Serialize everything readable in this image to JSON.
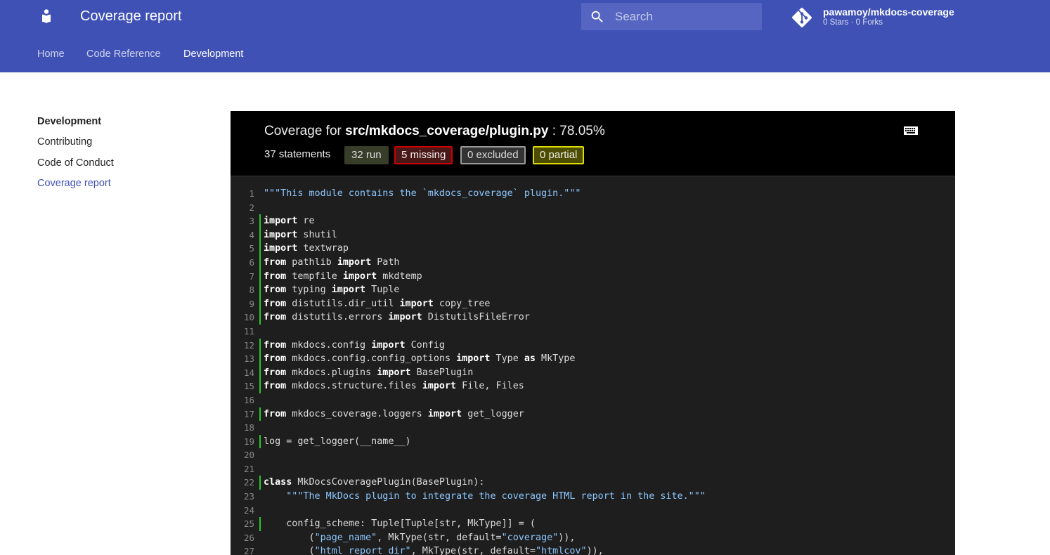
{
  "header": {
    "site_title": "Coverage report",
    "search_placeholder": "Search",
    "repo_name": "pawamoy/mkdocs-coverage",
    "repo_facts": "0 Stars · 0 Forks",
    "accent_color": "#3f51b5"
  },
  "tabs": [
    {
      "label": "Home",
      "active": false
    },
    {
      "label": "Code Reference",
      "active": false
    },
    {
      "label": "Development",
      "active": true
    }
  ],
  "sidebar": {
    "title": "Development",
    "items": [
      {
        "label": "Contributing",
        "active": false
      },
      {
        "label": "Code of Conduct",
        "active": false
      },
      {
        "label": "Coverage report",
        "active": true
      }
    ]
  },
  "report": {
    "title_prefix": "Coverage for ",
    "file_path": "src/mkdocs_coverage/plugin.py",
    "title_suffix": " : 78.05%",
    "statements": "37 statements",
    "run": "32 run",
    "missing": "5 missing",
    "excluded": "0 excluded",
    "partial": "0 partial",
    "icons": {
      "keyboard": "keyboard-icon"
    }
  },
  "code_lines": [
    {
      "n": "1",
      "run": false,
      "tokens": [
        [
          "s",
          "\"\"\"This module contains the `mkdocs_coverage` plugin.\"\"\""
        ]
      ]
    },
    {
      "n": "2",
      "run": false,
      "tokens": []
    },
    {
      "n": "3",
      "run": true,
      "tokens": [
        [
          "k",
          "import"
        ],
        [
          "t",
          " re"
        ]
      ]
    },
    {
      "n": "4",
      "run": true,
      "tokens": [
        [
          "k",
          "import"
        ],
        [
          "t",
          " shutil"
        ]
      ]
    },
    {
      "n": "5",
      "run": true,
      "tokens": [
        [
          "k",
          "import"
        ],
        [
          "t",
          " textwrap"
        ]
      ]
    },
    {
      "n": "6",
      "run": true,
      "tokens": [
        [
          "k",
          "from"
        ],
        [
          "t",
          " pathlib "
        ],
        [
          "k",
          "import"
        ],
        [
          "t",
          " Path"
        ]
      ]
    },
    {
      "n": "7",
      "run": true,
      "tokens": [
        [
          "k",
          "from"
        ],
        [
          "t",
          " tempfile "
        ],
        [
          "k",
          "import"
        ],
        [
          "t",
          " mkdtemp"
        ]
      ]
    },
    {
      "n": "8",
      "run": true,
      "tokens": [
        [
          "k",
          "from"
        ],
        [
          "t",
          " typing "
        ],
        [
          "k",
          "import"
        ],
        [
          "t",
          " Tuple"
        ]
      ]
    },
    {
      "n": "9",
      "run": true,
      "tokens": [
        [
          "k",
          "from"
        ],
        [
          "t",
          " distutils.dir_util "
        ],
        [
          "k",
          "import"
        ],
        [
          "t",
          " copy_tree"
        ]
      ]
    },
    {
      "n": "10",
      "run": true,
      "tokens": [
        [
          "k",
          "from"
        ],
        [
          "t",
          " distutils.errors "
        ],
        [
          "k",
          "import"
        ],
        [
          "t",
          " DistutilsFileError"
        ]
      ]
    },
    {
      "n": "11",
      "run": false,
      "tokens": []
    },
    {
      "n": "12",
      "run": true,
      "tokens": [
        [
          "k",
          "from"
        ],
        [
          "t",
          " mkdocs.config "
        ],
        [
          "k",
          "import"
        ],
        [
          "t",
          " Config"
        ]
      ]
    },
    {
      "n": "13",
      "run": true,
      "tokens": [
        [
          "k",
          "from"
        ],
        [
          "t",
          " mkdocs.config.config_options "
        ],
        [
          "k",
          "import"
        ],
        [
          "t",
          " Type "
        ],
        [
          "k",
          "as"
        ],
        [
          "t",
          " MkType"
        ]
      ]
    },
    {
      "n": "14",
      "run": true,
      "tokens": [
        [
          "k",
          "from"
        ],
        [
          "t",
          " mkdocs.plugins "
        ],
        [
          "k",
          "import"
        ],
        [
          "t",
          " BasePlugin"
        ]
      ]
    },
    {
      "n": "15",
      "run": true,
      "tokens": [
        [
          "k",
          "from"
        ],
        [
          "t",
          " mkdocs.structure.files "
        ],
        [
          "k",
          "import"
        ],
        [
          "t",
          " File, Files"
        ]
      ]
    },
    {
      "n": "16",
      "run": false,
      "tokens": []
    },
    {
      "n": "17",
      "run": true,
      "tokens": [
        [
          "k",
          "from"
        ],
        [
          "t",
          " mkdocs_coverage.loggers "
        ],
        [
          "k",
          "import"
        ],
        [
          "t",
          " get_logger"
        ]
      ]
    },
    {
      "n": "18",
      "run": false,
      "tokens": []
    },
    {
      "n": "19",
      "run": true,
      "tokens": [
        [
          "t",
          "log = get_logger(__name__)"
        ]
      ]
    },
    {
      "n": "20",
      "run": false,
      "tokens": []
    },
    {
      "n": "21",
      "run": false,
      "tokens": []
    },
    {
      "n": "22",
      "run": true,
      "tokens": [
        [
          "k",
          "class"
        ],
        [
          "t",
          " MkDocsCoveragePlugin(BasePlugin):"
        ]
      ]
    },
    {
      "n": "23",
      "run": false,
      "tokens": [
        [
          "t",
          "    "
        ],
        [
          "s",
          "\"\"\"The MkDocs plugin to integrate the coverage HTML report in the site.\"\"\""
        ]
      ]
    },
    {
      "n": "24",
      "run": false,
      "tokens": []
    },
    {
      "n": "25",
      "run": true,
      "tokens": [
        [
          "t",
          "    config_scheme: Tuple[Tuple[str, MkType]] = ("
        ]
      ]
    },
    {
      "n": "26",
      "run": false,
      "tokens": [
        [
          "t",
          "        ("
        ],
        [
          "s",
          "\"page_name\""
        ],
        [
          "t",
          ", MkType(str, default="
        ],
        [
          "s",
          "\"coverage\""
        ],
        [
          "t",
          ")),"
        ]
      ]
    },
    {
      "n": "27",
      "run": false,
      "tokens": [
        [
          "t",
          "        ("
        ],
        [
          "s",
          "\"html_report_dir\""
        ],
        [
          "t",
          ", MkType(str, default="
        ],
        [
          "s",
          "\"htmlcov\""
        ],
        [
          "t",
          ")),"
        ]
      ]
    }
  ]
}
